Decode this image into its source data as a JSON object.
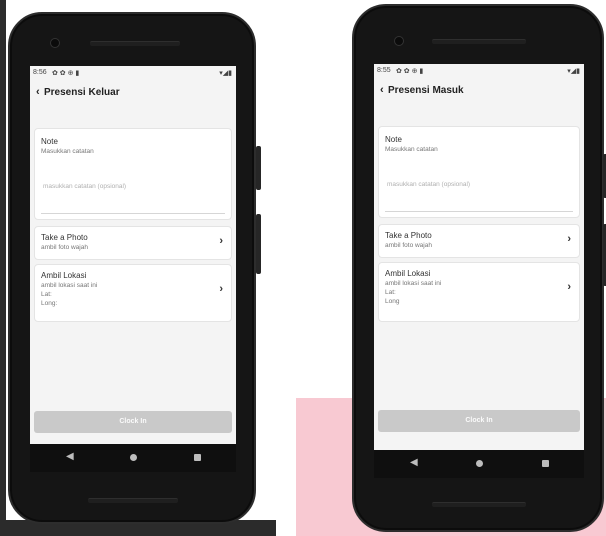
{
  "phone_left": {
    "status_time": "8:56",
    "status_icons": "✿ ✿ ⊕ ▮",
    "status_right": "▾◢▮",
    "title": "Presensi Keluar",
    "note": {
      "title": "Note",
      "subtitle": "Masukkan catatan",
      "placeholder": "masukkan catatan (opsional)"
    },
    "photo": {
      "title": "Take a Photo",
      "subtitle": "ambil foto wajah"
    },
    "location": {
      "title": "Ambil Lokasi",
      "subtitle": "ambil lokasi saat ini",
      "lat": "Lat:",
      "long": "Long:"
    },
    "button": "Clock In"
  },
  "phone_right": {
    "status_time": "8:55",
    "status_icons": "✿ ✿ ⊕ ▮",
    "status_right": "▾◢▮",
    "title": "Presensi Masuk",
    "note": {
      "title": "Note",
      "subtitle": "Masukkan catatan",
      "placeholder": "masukkan catatan (opsional)"
    },
    "photo": {
      "title": "Take a Photo",
      "subtitle": "ambil foto wajah"
    },
    "location": {
      "title": "Ambil Lokasi",
      "subtitle": "ambil lokasi saat ini",
      "lat": "Lat:",
      "long": "Long"
    },
    "button": "Clock In"
  },
  "icons": {
    "back": "back-chevron-icon",
    "next": "chevron-right-icon",
    "nav_back": "nav-back-icon",
    "nav_home": "nav-home-icon",
    "nav_recents": "nav-recents-icon"
  },
  "colors": {
    "button_disabled": "#c9c9c9",
    "screen_bg": "#f4f4f4",
    "phone_body": "#151515",
    "backdrop_pink": "#f8c9d2"
  }
}
